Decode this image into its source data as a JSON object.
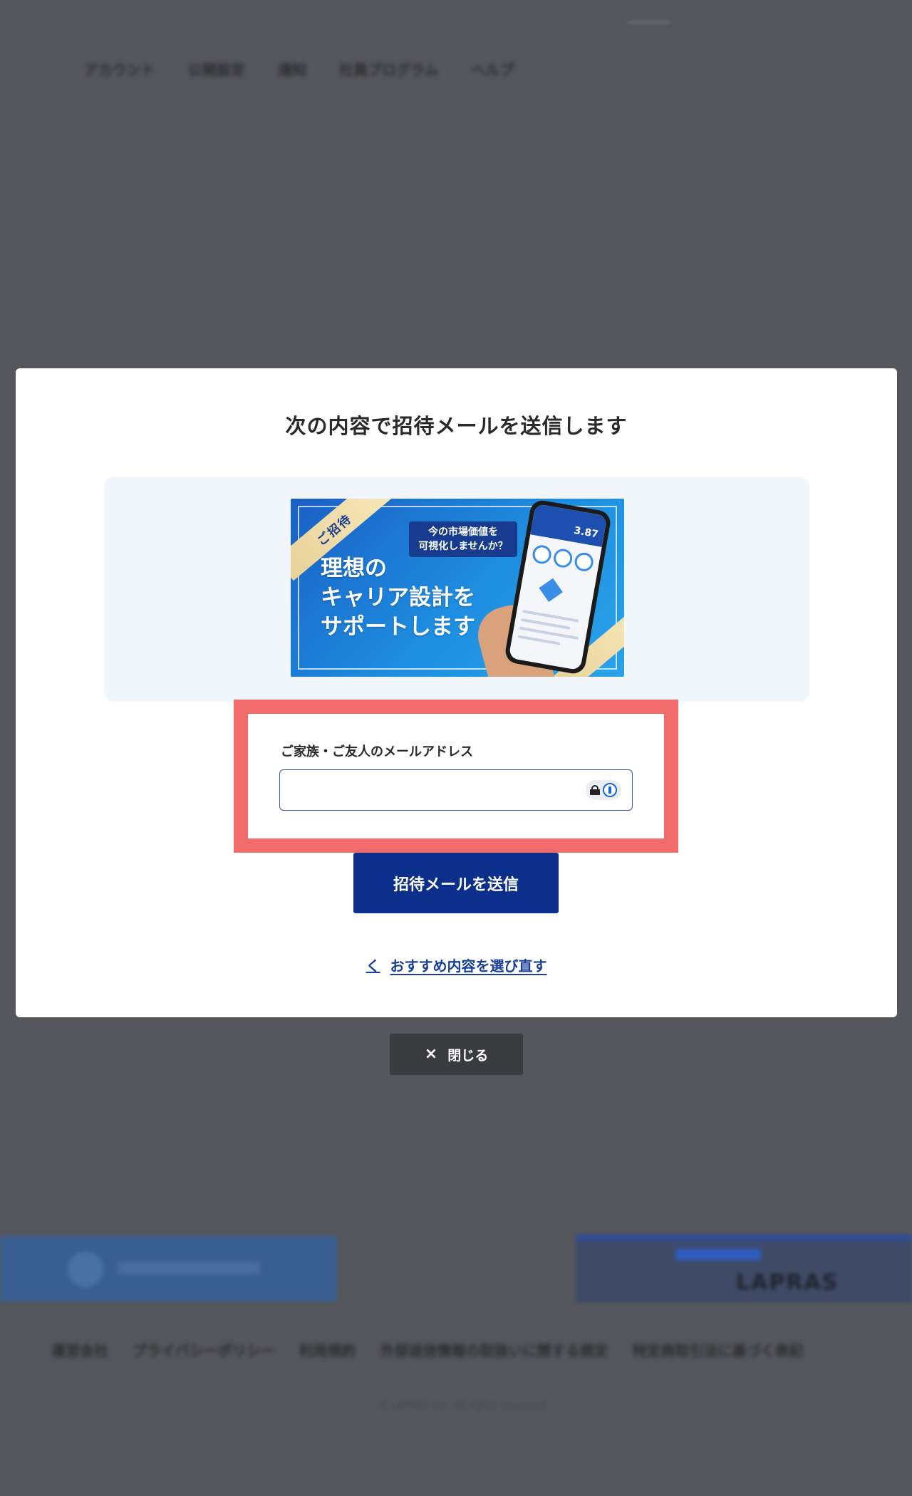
{
  "background": {
    "nav_items": [
      "アカウント",
      "公開設定",
      "通知",
      "社員プログラム",
      "ヘルプ"
    ],
    "banner_right_word": "LAPRAS",
    "footer_links": [
      "運営会社",
      "プライバシーポリシー",
      "利用規約",
      "外部送信情報の取扱いに関する規定",
      "特定商取引法に基づく表記"
    ],
    "copyright": "© LAPRAS Inc. All rights reserved."
  },
  "modal": {
    "title": "次の内容で招待メールを送信します",
    "banner": {
      "ribbon": "ご招待",
      "bubble_line1": "今の市場価値を",
      "bubble_line2": "可視化しませんか？",
      "headline_line1": "理想の",
      "headline_line2": "キャリア設計を",
      "headline_line3": "サポートします",
      "score": "3.87"
    },
    "email": {
      "label": "ご家族・ご友人のメールアドレス",
      "value": "",
      "placeholder": ""
    },
    "send_label": "招待メールを送信",
    "back_label": "おすすめ内容を選び直す",
    "back_chevron": "く"
  },
  "close": {
    "label": "閉じる",
    "icon": "×"
  },
  "colors": {
    "overlay": "#55565b",
    "primary": "#0b2f8a",
    "highlight": "#f26b6b",
    "link": "#1a3f9a"
  }
}
